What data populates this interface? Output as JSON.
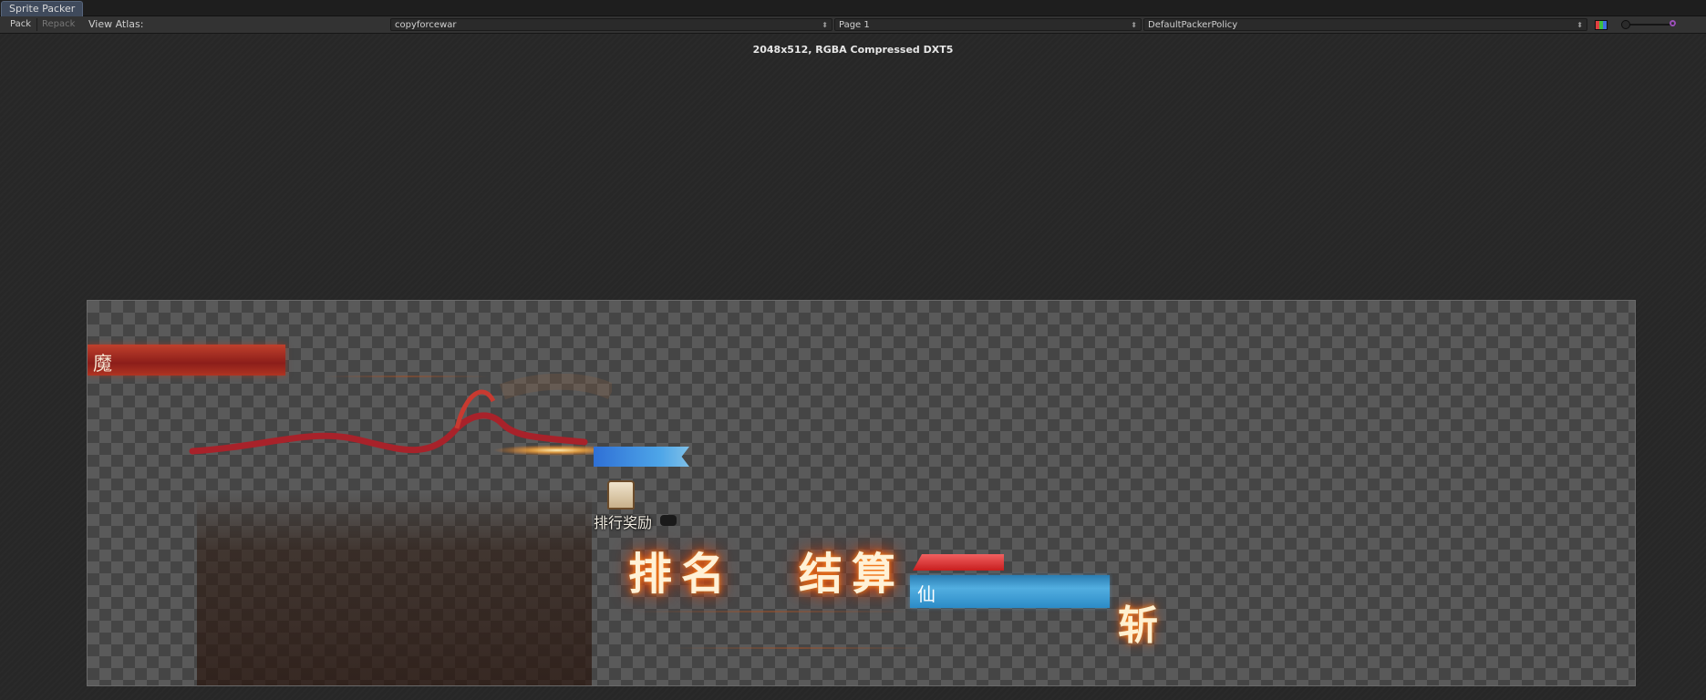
{
  "window": {
    "tab_title": "Sprite Packer"
  },
  "toolbar": {
    "pack_label": "Pack",
    "repack_label": "Repack",
    "view_atlas_label": "View Atlas:",
    "atlas_dropdown": "copyforcewar",
    "page_dropdown": "Page 1",
    "policy_dropdown": "DefaultPackerPolicy",
    "color_mode_icon": "rgb-channels-icon",
    "zoom_icon": "zoom-slider-icon"
  },
  "atlas": {
    "info": "2048x512, RGBA Compressed DXT5",
    "sprites": {
      "demon_glyph": "魔",
      "immortal_glyph": "仙",
      "reward_label": "排行奖励",
      "rank_title": "排名",
      "settle_title": "结算",
      "slash_glyph": "斩"
    }
  }
}
